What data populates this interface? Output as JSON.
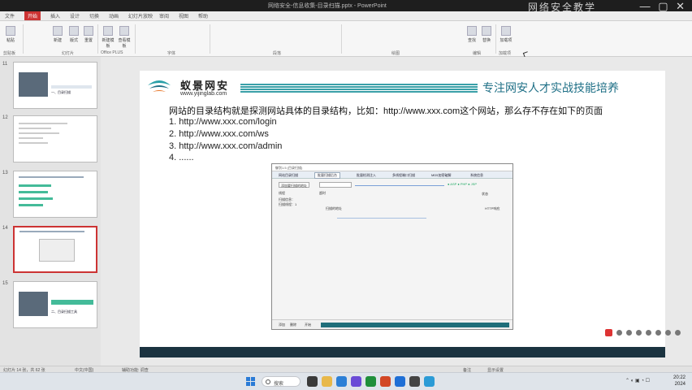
{
  "window": {
    "title": "网络安全-信息收集-目录扫描.pptx - PowerPoint",
    "overlay_text": "网络安全教学"
  },
  "ribbon": {
    "tabs": [
      "文件",
      "开始",
      "插入",
      "设计",
      "切换",
      "动画",
      "幻灯片放映",
      "审阅",
      "视图",
      "帮助"
    ],
    "active_tab": "开始",
    "groups": [
      "剪贴板",
      "幻灯片",
      "Office PLUS",
      "字体",
      "段落",
      "绘图",
      "编辑",
      "加载项"
    ],
    "buttons": [
      "粘贴",
      "新建",
      "版式",
      "重置",
      "节",
      "新建模板",
      "查看模板",
      "查找",
      "替换",
      "选择",
      "加载项"
    ]
  },
  "slides": [
    {
      "num": "11",
      "title": "一、目录扫描"
    },
    {
      "num": "12",
      "title": ""
    },
    {
      "num": "13",
      "title": ""
    },
    {
      "num": "14",
      "title": ""
    },
    {
      "num": "15",
      "title": "二、目录扫描工具"
    }
  ],
  "slide": {
    "logo_name": "蚁景网安",
    "logo_url": "www.yijinglab.com",
    "slogan": "专注网安人才实战技能培养",
    "heading": "网站的目录结构就是探测网站具体的目录结构，比如：http://www.xxx.com这个网站，那么存不存在如下的页面",
    "list": [
      "1.  http://www.xxx.com/login",
      "2.  http://www.xxx.com/ws",
      "3.  http://www.xxx.com/admin",
      "4.  ......"
    ],
    "embedded_app": {
      "title": "御剑1.5 (目录扫描)",
      "tabs": [
        "网站目录扫描",
        "批量扫描后台",
        "批量检测注入",
        "多线程端口扫描",
        "MD5加密破解",
        "系统信息"
      ],
      "labels": {
        "domain": "添加要扫描的地址",
        "thread": "线程",
        "timeout": "超时",
        "scan_info": "扫描信息：",
        "count": "扫描线程：1",
        "status": "状态",
        "result_header": "扫描的地址",
        "code_header": "HTTP响应"
      },
      "bottom_labels": [
        "添加",
        "删除",
        "开始"
      ],
      "progress": 1.0
    }
  },
  "status_bar": {
    "slide_pos": "幻灯片 14 张，共 62 张",
    "language": "中文(中国)",
    "accessibility": "辅助功能: 调查",
    "notes": "备注",
    "view": "显示设置"
  },
  "taskbar": {
    "search_placeholder": "搜索",
    "time": "20:22",
    "date": "2024"
  }
}
